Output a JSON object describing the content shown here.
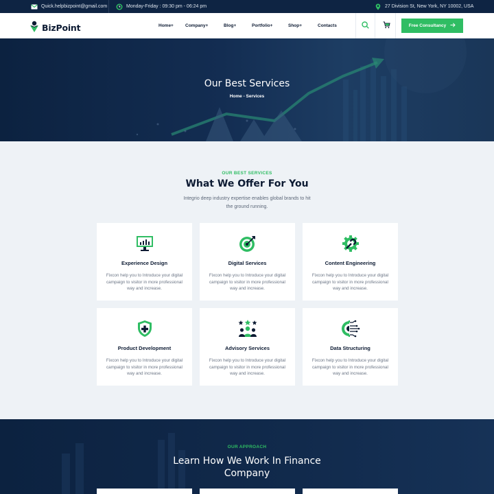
{
  "topbar": {
    "email": "Quick.helpbizpoint@gmail.com",
    "hours": "Monday-Friday : 09:30 pm - 06:24 pm",
    "address": "27 Division St, New York, NY 10002, USA",
    "icons": [
      "mail-icon",
      "clock-icon",
      "location-pin-icon"
    ]
  },
  "header": {
    "logo_text": "BizPoint",
    "nav": [
      {
        "label": "Home+"
      },
      {
        "label": "Company+"
      },
      {
        "label": "Blog+"
      },
      {
        "label": "Portfolio+"
      },
      {
        "label": "Shop+"
      },
      {
        "label": "Contacts"
      }
    ],
    "cta_label": "Free Consultancy",
    "icons": [
      "search-icon",
      "cart-icon",
      "arrow-right-icon"
    ]
  },
  "hero": {
    "title": "Our Best Services",
    "breadcrumb": "Home - Services"
  },
  "services": {
    "kicker": "OUR BEST SERVICES",
    "title": "What We Offer For You",
    "subtitle_line1": "Integrio deep industry expertise enables global brands to hit",
    "subtitle_line2": "the ground running.",
    "cards": [
      {
        "title": "Experience Design",
        "icon": "monitor-chart-icon",
        "line1": "Fixcon help you to Introduce your digital",
        "line2": "campaign to visitor in more professional",
        "line3": "way and increase."
      },
      {
        "title": "Digital Services",
        "icon": "target-icon",
        "line1": "Fixcon help you to Introduce your digital",
        "line2": "campaign to visitor in more professional",
        "line3": "way and increase."
      },
      {
        "title": "Content Engineering",
        "icon": "gear-wrench-icon",
        "line1": "Fixcon help you to Introduce your digital",
        "line2": "campaign to visitor in more professional",
        "line3": "way and increase."
      },
      {
        "title": "Product Development",
        "icon": "shield-plus-icon",
        "line1": "Fixcon help you to Introduce your digital",
        "line2": "campaign to visitor in more professional",
        "line3": "way and increase."
      },
      {
        "title": "Advisory Services",
        "icon": "team-stars-icon",
        "line1": "Fixcon help you to Introduce your digital",
        "line2": "campaign to visitor in more professional",
        "line3": "way and increase."
      },
      {
        "title": "Data Structuring",
        "icon": "gear-circuit-icon",
        "line1": "Fixcon help you to Introduce your digital",
        "line2": "campaign to visitor in more professional",
        "line3": "way and increase."
      }
    ]
  },
  "approach": {
    "kicker": "OUR APPROACH",
    "title_line1": "Learn How We Work In Finance",
    "title_line2": "Company"
  },
  "colors": {
    "brand_green": "#2fbd63",
    "navy": "#0e2443",
    "text_dark": "#0d1b33"
  }
}
